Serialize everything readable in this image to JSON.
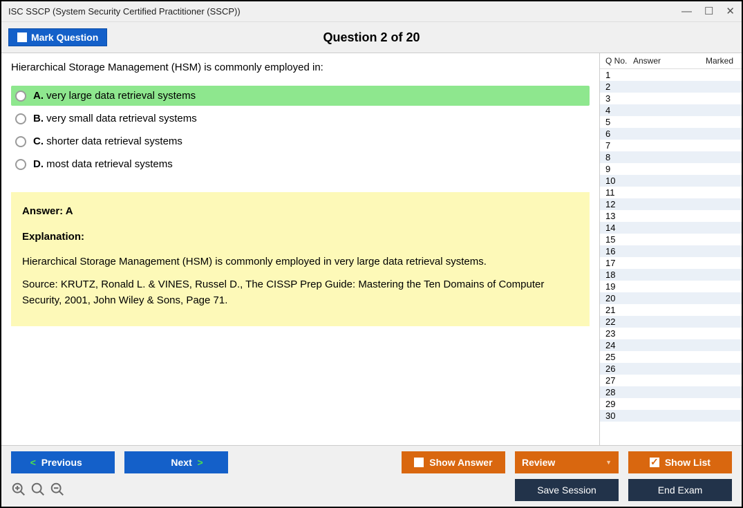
{
  "window_title": "ISC SSCP (System Security Certified Practitioner (SSCP))",
  "header": {
    "mark_label": "Mark Question",
    "question_header": "Question 2 of 20"
  },
  "question": {
    "text": "Hierarchical Storage Management (HSM) is commonly employed in:",
    "choices": {
      "a": {
        "letter": "A.",
        "text": " very large data retrieval systems"
      },
      "b": {
        "letter": "B.",
        "text": " very small data retrieval systems"
      },
      "c": {
        "letter": "C.",
        "text": " shorter data retrieval systems"
      },
      "d": {
        "letter": "D.",
        "text": " most data retrieval systems"
      }
    }
  },
  "answer_box": {
    "answer_label": "Answer: A",
    "explanation_label": "Explanation:",
    "p1": "Hierarchical Storage Management (HSM) is commonly employed in very large data retrieval systems.",
    "p2": "Source: KRUTZ, Ronald L. & VINES, Russel D., The CISSP Prep Guide: Mastering the Ten Domains of Computer Security, 2001, John Wiley & Sons, Page 71."
  },
  "side": {
    "h_qno": "Q No.",
    "h_answer": "Answer",
    "h_marked": "Marked",
    "rows": [
      "1",
      "2",
      "3",
      "4",
      "5",
      "6",
      "7",
      "8",
      "9",
      "10",
      "11",
      "12",
      "13",
      "14",
      "15",
      "16",
      "17",
      "18",
      "19",
      "20",
      "21",
      "22",
      "23",
      "24",
      "25",
      "26",
      "27",
      "28",
      "29",
      "30"
    ]
  },
  "footer": {
    "previous": "Previous",
    "next": "Next",
    "show_answer": "Show Answer",
    "review": "Review",
    "show_list": "Show List",
    "save_session": "Save Session",
    "end_exam": "End Exam"
  }
}
